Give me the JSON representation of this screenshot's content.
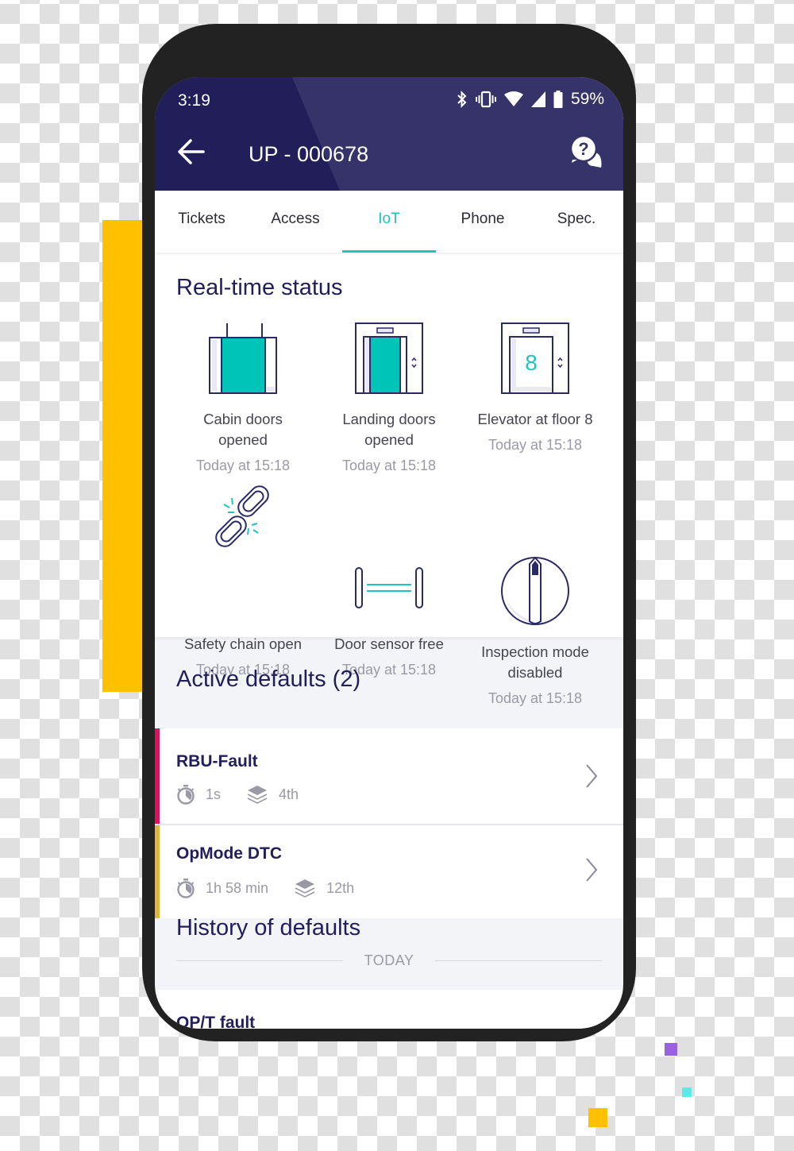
{
  "status_bar": {
    "time": "3:19",
    "battery_percent": "59%",
    "icons": [
      "bluetooth-icon",
      "vibrate-icon",
      "wifi-icon",
      "cell-signal-icon",
      "battery-icon"
    ]
  },
  "app_bar": {
    "title": "UP - 000678",
    "back_icon": "arrow-left-icon",
    "help_icon": "help-chat-icon"
  },
  "tabs": [
    {
      "label": "Tickets",
      "active": false
    },
    {
      "label": "Access",
      "active": false
    },
    {
      "label": "IoT",
      "active": true
    },
    {
      "label": "Phone",
      "active": false
    },
    {
      "label": "Spec.",
      "active": false
    }
  ],
  "realtime": {
    "title": "Real-time status",
    "items": [
      {
        "icon": "cabin-doors-icon",
        "label_line1": "Cabin doors",
        "label_line2": "opened",
        "time": "Today at 15:18"
      },
      {
        "icon": "landing-doors-icon",
        "label_line1": "Landing doors",
        "label_line2": "opened",
        "time": "Today at 15:18"
      },
      {
        "icon": "elevator-floor-icon",
        "floor": "8",
        "label_line1": "Elevator at floor 8",
        "label_line2": "",
        "time": "Today at 15:18"
      },
      {
        "icon": "broken-chain-icon",
        "label_line1": "Safety chain open",
        "label_line2": "",
        "time": "Today at 15:18"
      },
      {
        "icon": "door-sensor-icon",
        "label_line1": "Door sensor free",
        "label_line2": "",
        "time": "Today at 15:18"
      },
      {
        "icon": "inspection-switch-icon",
        "label_line1": "Inspection mode",
        "label_line2": "disabled",
        "time": "Today at 15:18"
      }
    ]
  },
  "active_defaults": {
    "title": "Active defaults (2)",
    "items": [
      {
        "name": "RBU-Fault",
        "duration": "1s",
        "floor": "4th",
        "severity_color": "#e0105a"
      },
      {
        "name": "OpMode DTC",
        "duration": "1h 58 min",
        "floor": "12th",
        "severity_color": "#e5b23e"
      }
    ]
  },
  "history": {
    "title": "History of defaults",
    "group_label": "TODAY",
    "items": [
      {
        "name": "OP/T fault"
      }
    ]
  },
  "colors": {
    "primary_dark": "#211e5a",
    "accent_teal": "#1fc4c0",
    "background": "#f3f4f8"
  }
}
